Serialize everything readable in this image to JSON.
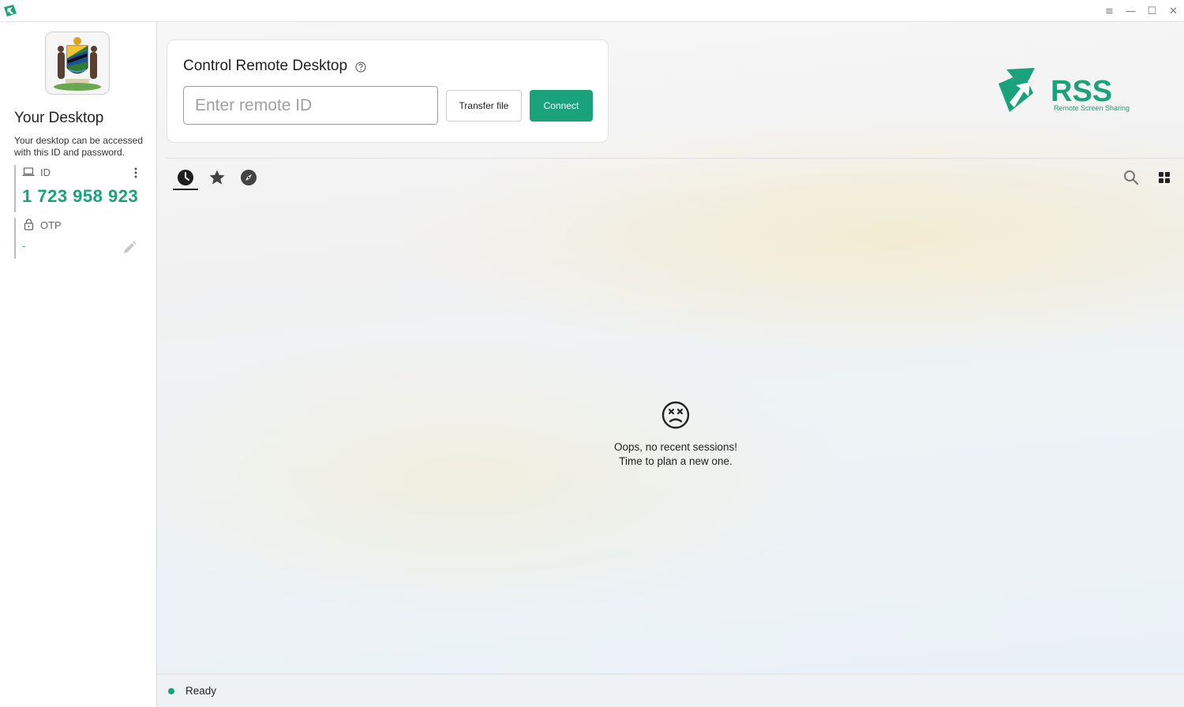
{
  "window": {
    "icon": "rss-app-icon",
    "controls": {
      "menu": "≡",
      "minimize": "—",
      "maximize": "☐",
      "close": "✕"
    }
  },
  "sidebar": {
    "emblem": "coat-of-arms-emblem",
    "title": "Your Desktop",
    "description": "Your desktop can be accessed with this ID and password.",
    "id_label": "ID",
    "id_value": "1 723 958 923",
    "otp_label": "OTP",
    "otp_value": "-"
  },
  "control": {
    "title": "Control Remote Desktop",
    "input_placeholder": "Enter remote ID",
    "input_value": "",
    "transfer_label": "Transfer file",
    "connect_label": "Connect"
  },
  "brand": {
    "logo_text": "RSS",
    "logo_subtext": "Remote Screen Sharing",
    "accent_color": "#1aa27a"
  },
  "tabs": [
    {
      "name": "recent-sessions",
      "icon": "clock-icon",
      "active": true
    },
    {
      "name": "favorites",
      "icon": "star-icon",
      "active": false
    },
    {
      "name": "discovered",
      "icon": "compass-icon",
      "active": false
    }
  ],
  "empty_state": {
    "icon": "sad-face-icon",
    "line1": "Oops, no recent sessions!",
    "line2": "Time to plan a new one."
  },
  "status": {
    "text": "Ready",
    "color": "#1aa27a"
  }
}
